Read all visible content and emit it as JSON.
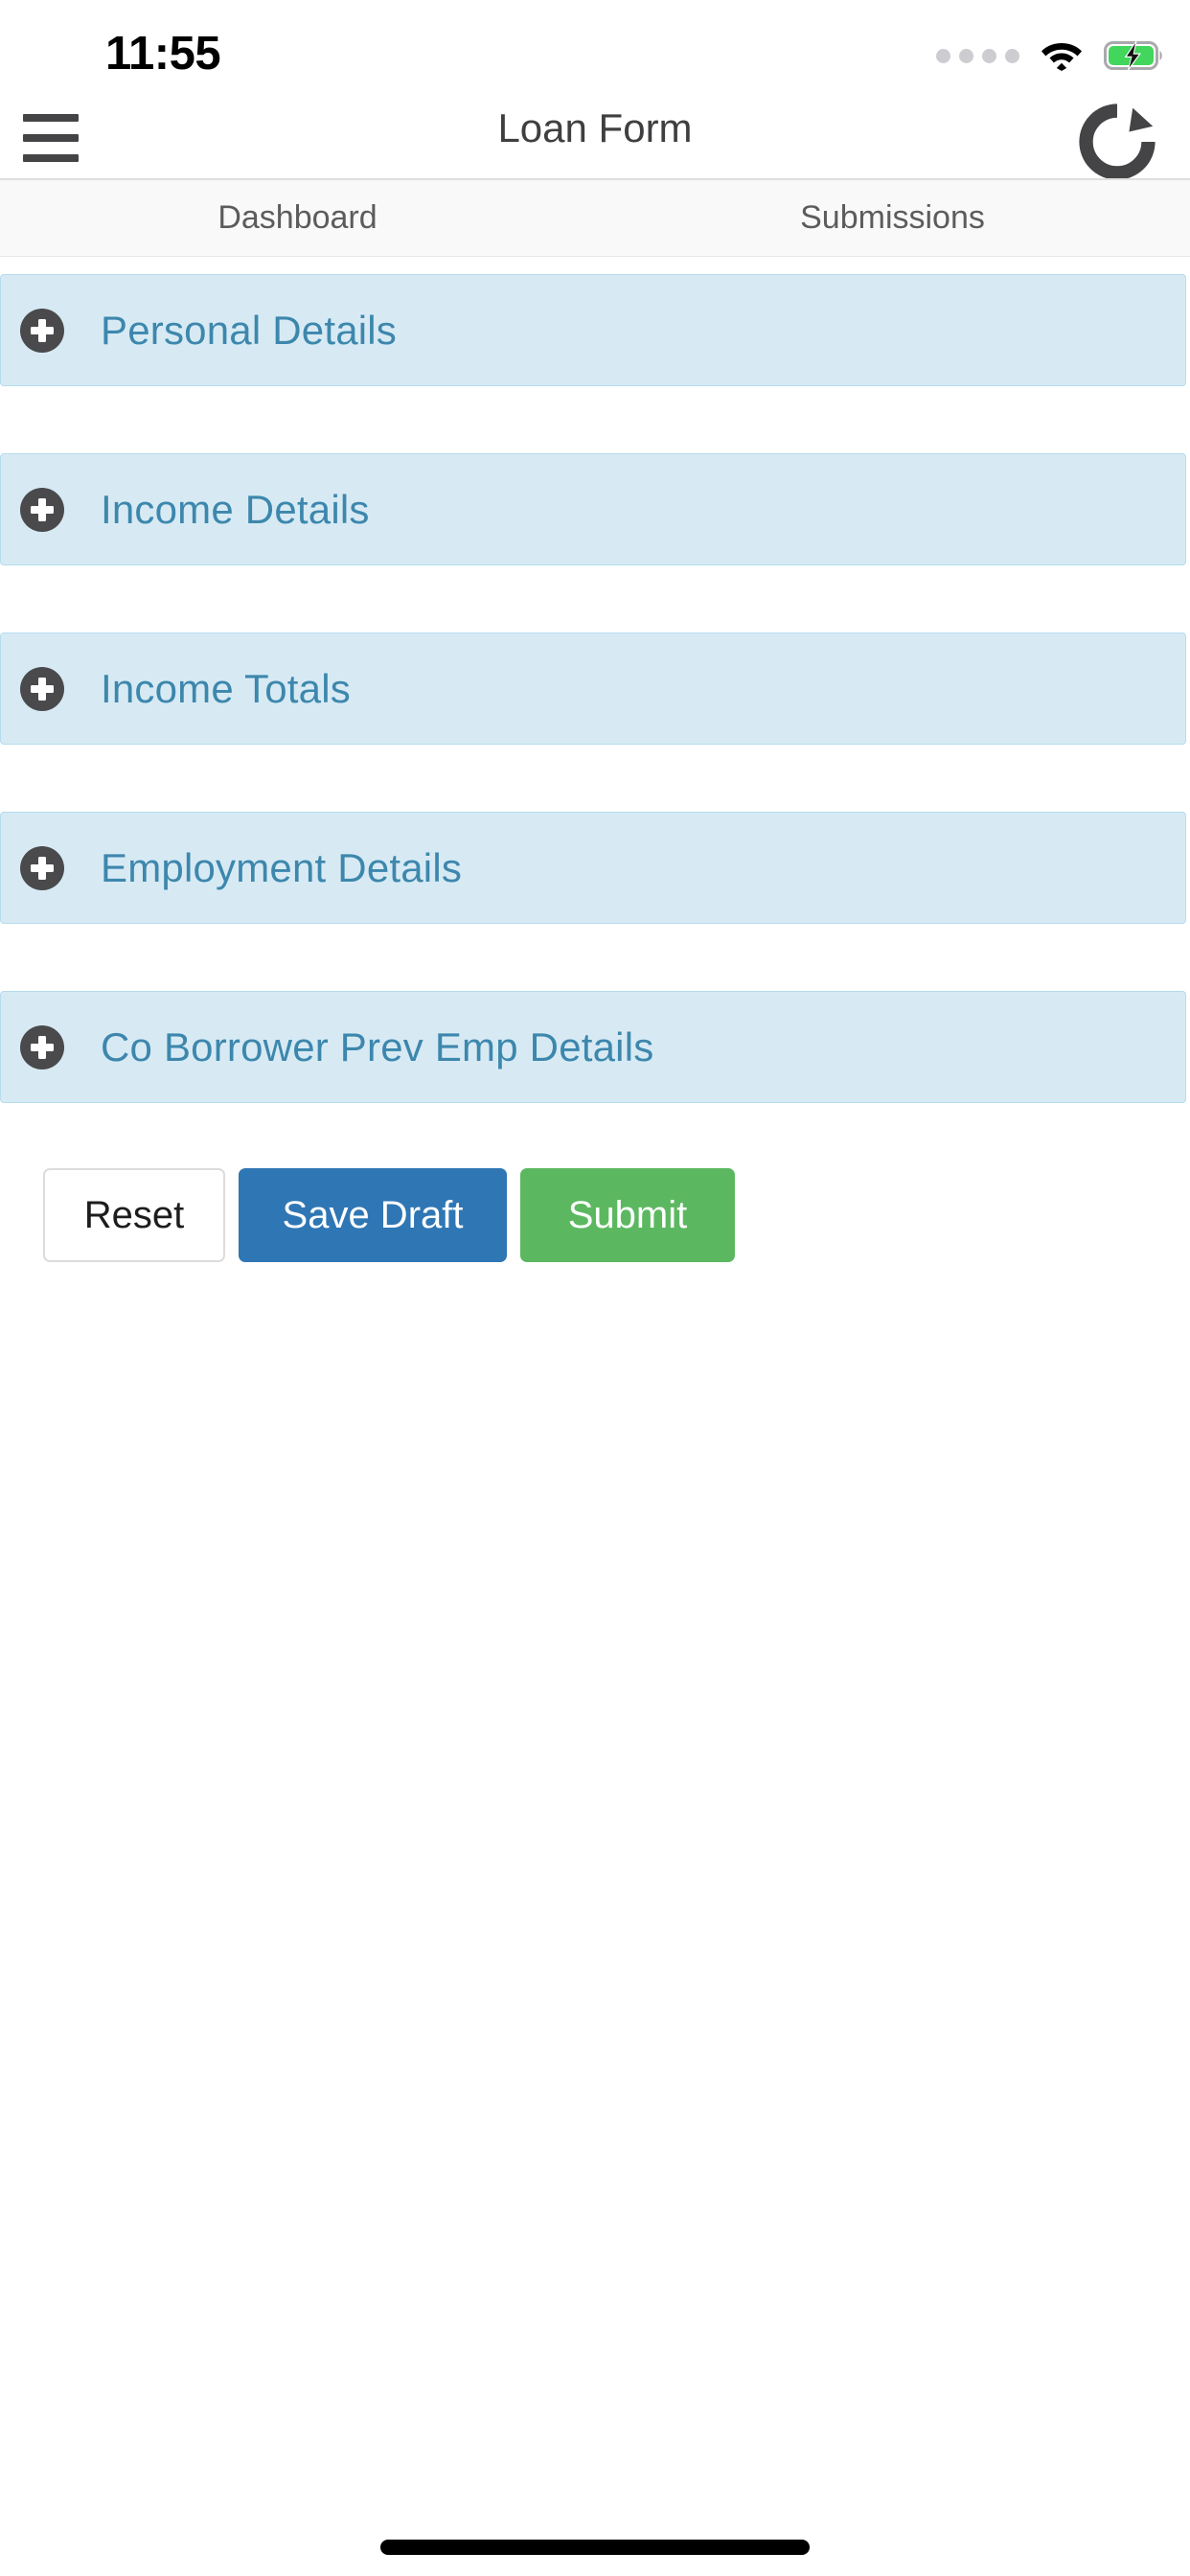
{
  "status_bar": {
    "time": "11:55",
    "signal_dots": 4,
    "wifi_icon": "wifi-icon",
    "battery_icon": "battery-charging-icon",
    "battery_color": "#42d65c"
  },
  "nav_bar": {
    "menu_icon": "hamburger-menu-icon",
    "title": "Loan Form",
    "refresh_icon": "refresh-icon"
  },
  "tabs": [
    {
      "label": "Dashboard"
    },
    {
      "label": "Submissions"
    }
  ],
  "accordion": {
    "expand_icon": "plus-circle-icon",
    "sections": [
      {
        "label": "Personal Details"
      },
      {
        "label": "Income Details"
      },
      {
        "label": "Income Totals"
      },
      {
        "label": "Employment Details"
      },
      {
        "label": "Co Borrower Prev Emp Details"
      }
    ]
  },
  "actions": {
    "reset_label": "Reset",
    "save_draft_label": "Save Draft",
    "submit_label": "Submit"
  },
  "colors": {
    "panel_background": "#d7eaf4",
    "panel_border": "#b5dced",
    "panel_text": "#3d87ad",
    "save_draft": "#2f76b4",
    "submit": "#5cb860",
    "reset_border": "#dcdcdc"
  }
}
